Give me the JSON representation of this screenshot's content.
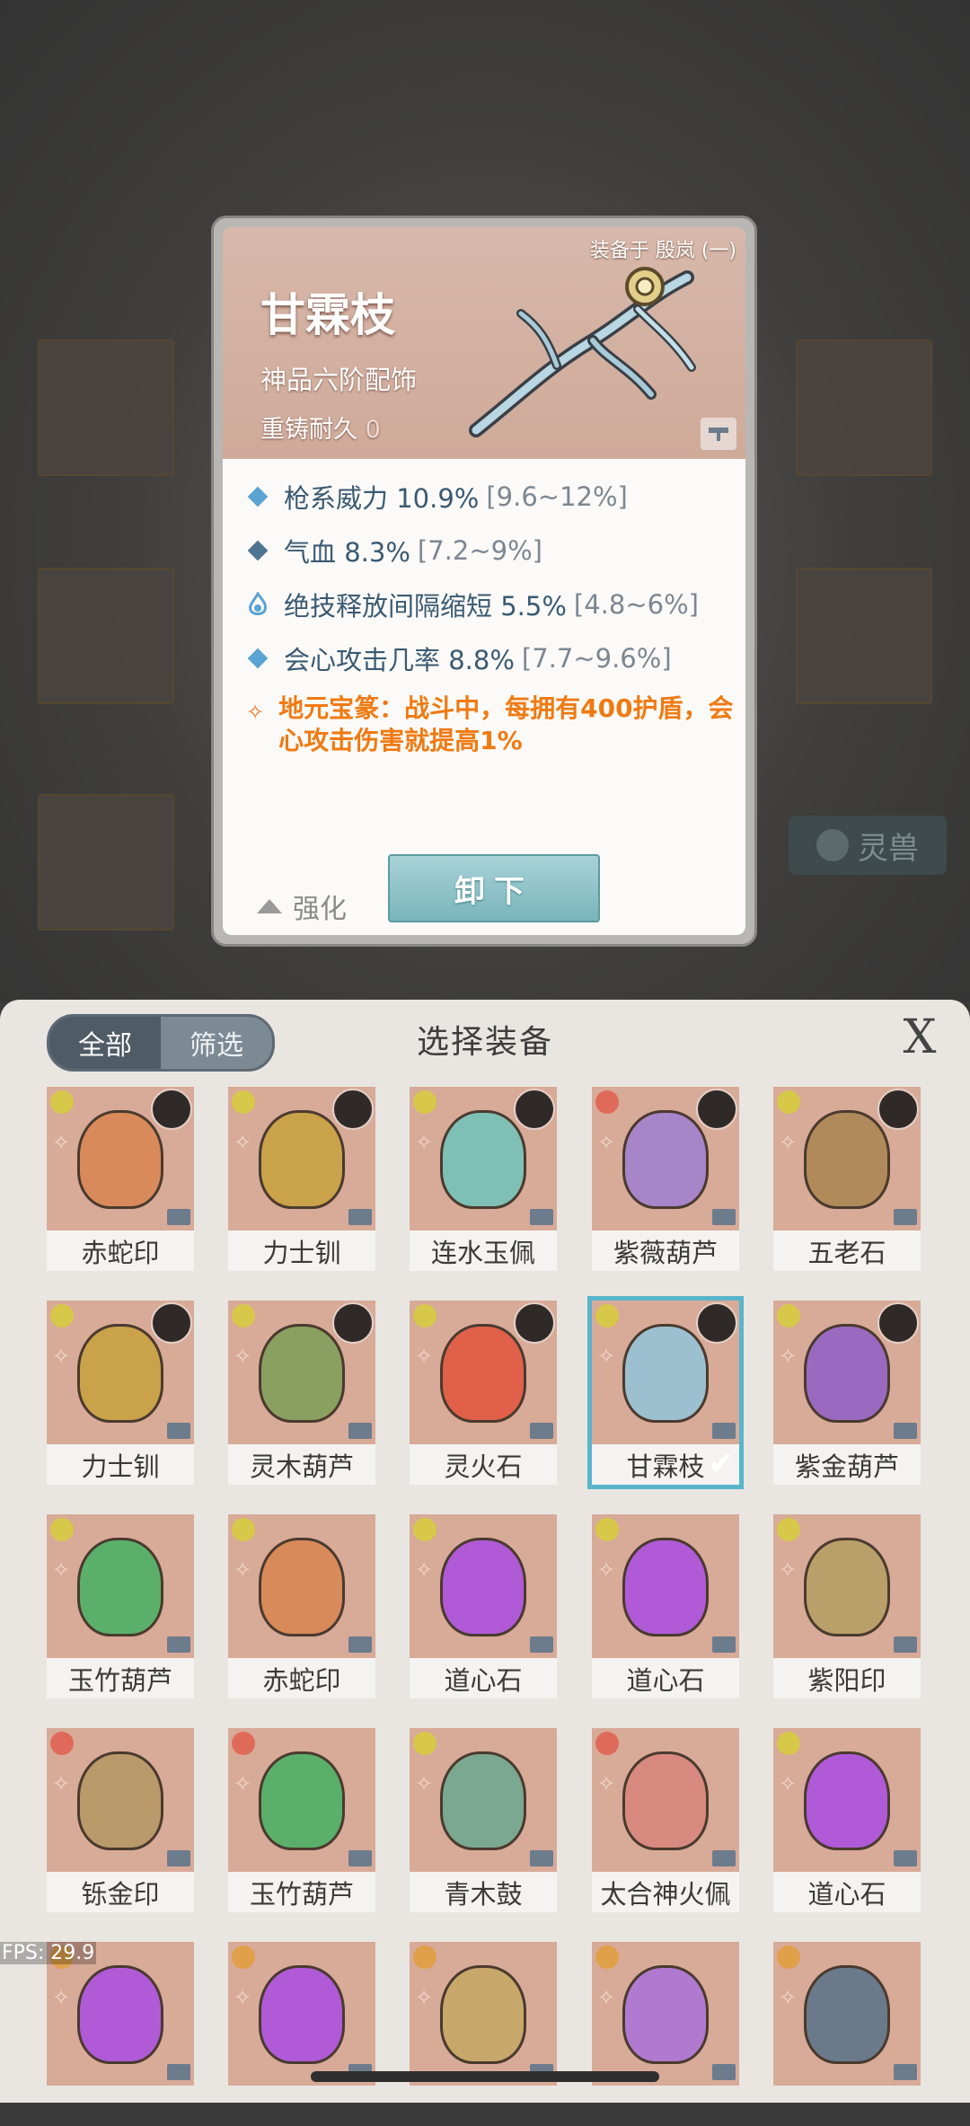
{
  "detail": {
    "equipped_to": "装备于 殷岚 (一)",
    "name": "甘霖枝",
    "grade": "神品六阶配饰",
    "reforge_label": "重铸耐久",
    "reforge_value": "0",
    "stats": [
      {
        "text": "枪系威力 10.9%",
        "range": "[9.6~12%]",
        "icon": "diamond-icon"
      },
      {
        "text": "气血 8.3%",
        "range": "[7.2~9%]",
        "icon": "diamond-icon"
      },
      {
        "text": "绝技释放间隔缩短 5.5%",
        "range": "[4.8~6%]",
        "icon": "flame-icon"
      },
      {
        "text": "会心攻击几率 8.8%",
        "range": "[7.7~9.6%]",
        "icon": "diamond-icon"
      }
    ],
    "special": "地元宝篆：战斗中，每拥有400护盾，会心攻击伤害就提高1%",
    "enhance_label": "强化",
    "unequip_label": "卸下"
  },
  "background": {
    "tag_label": "灵兽"
  },
  "panel": {
    "tab_all": "全部",
    "tab_filter": "筛选",
    "title": "选择装备",
    "close": "X"
  },
  "items": [
    {
      "name": "赤蛇印",
      "color": "#d98a5a",
      "portrait": true,
      "quality": "#d8c84a"
    },
    {
      "name": "力士钏",
      "color": "#caa24a",
      "portrait": true,
      "quality": "#d8c84a"
    },
    {
      "name": "连水玉佩",
      "color": "#7fc0b6",
      "portrait": true,
      "quality": "#d8c84a"
    },
    {
      "name": "紫薇葫芦",
      "color": "#a884c8",
      "portrait": true,
      "quality": "#e06a5a"
    },
    {
      "name": "五老石",
      "color": "#b08a5a",
      "portrait": true,
      "quality": "#d8c84a"
    },
    {
      "name": "力士钏",
      "color": "#caa24a",
      "portrait": true,
      "quality": "#d8c84a"
    },
    {
      "name": "灵木葫芦",
      "color": "#8aa060",
      "portrait": true,
      "quality": "#d8c84a"
    },
    {
      "name": "灵火石",
      "color": "#e0604a",
      "portrait": true,
      "quality": "#d8c84a"
    },
    {
      "name": "甘霖枝",
      "color": "#9cc0d0",
      "portrait": true,
      "quality": "#d8c84a",
      "selected": true
    },
    {
      "name": "紫金葫芦",
      "color": "#9a6ac0",
      "portrait": true,
      "quality": "#d8c84a"
    },
    {
      "name": "玉竹葫芦",
      "color": "#5ab06a",
      "portrait": false,
      "quality": "#d8c84a"
    },
    {
      "name": "赤蛇印",
      "color": "#d98a5a",
      "portrait": false,
      "quality": "#d8c84a"
    },
    {
      "name": "道心石",
      "color": "#b05ad8",
      "portrait": false,
      "quality": "#d8c84a"
    },
    {
      "name": "道心石",
      "color": "#b05ad8",
      "portrait": false,
      "quality": "#d8c84a"
    },
    {
      "name": "紫阳印",
      "color": "#b9a06a",
      "portrait": false,
      "quality": "#d8c84a"
    },
    {
      "name": "铄金印",
      "color": "#b99a6a",
      "portrait": false,
      "quality": "#e06a5a"
    },
    {
      "name": "玉竹葫芦",
      "color": "#5ab06a",
      "portrait": false,
      "quality": "#e06a5a"
    },
    {
      "name": "青木鼓",
      "color": "#7aa890",
      "portrait": false,
      "quality": "#d8c84a"
    },
    {
      "name": "太合神火佩",
      "color": "#d88a80",
      "portrait": false,
      "quality": "#e06a5a"
    },
    {
      "name": "道心石",
      "color": "#b05ad8",
      "portrait": false,
      "quality": "#d8c84a"
    },
    {
      "name": "",
      "color": "#b05ad8",
      "portrait": false,
      "quality": "#e0a04a"
    },
    {
      "name": "",
      "color": "#b05ad8",
      "portrait": false,
      "quality": "#e0a04a"
    },
    {
      "name": "",
      "color": "#c8a86a",
      "portrait": false,
      "quality": "#e0a04a"
    },
    {
      "name": "",
      "color": "#b07ad0",
      "portrait": false,
      "quality": "#e0a04a"
    },
    {
      "name": "",
      "color": "#6a7a8a",
      "portrait": false,
      "quality": "#e0a04a"
    }
  ],
  "fps": "FPS: 29.9"
}
